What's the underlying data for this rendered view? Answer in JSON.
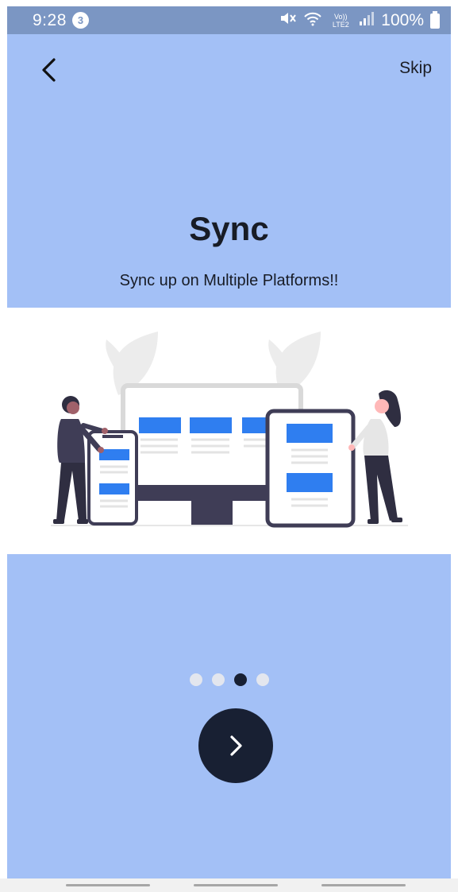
{
  "status_bar": {
    "time": "9:28",
    "notification_count": "3",
    "network_label": "Vo)) LTE2",
    "battery_percent": "100%",
    "icons": [
      "mute-icon",
      "wifi-icon",
      "signal-icon",
      "battery-icon"
    ]
  },
  "header": {
    "back_icon": "chevron-left-icon",
    "skip_label": "Skip"
  },
  "content": {
    "title": "Sync",
    "subtitle": "Sync up on Multiple Platforms!!"
  },
  "pager": {
    "total": 4,
    "active_index": 2
  },
  "next_button": {
    "icon": "chevron-right-icon"
  },
  "colors": {
    "background": "#a3c0f6",
    "status_bar": "#7b96c3",
    "accent_dark": "#182033",
    "illustration_blue": "#2f7ef0"
  }
}
